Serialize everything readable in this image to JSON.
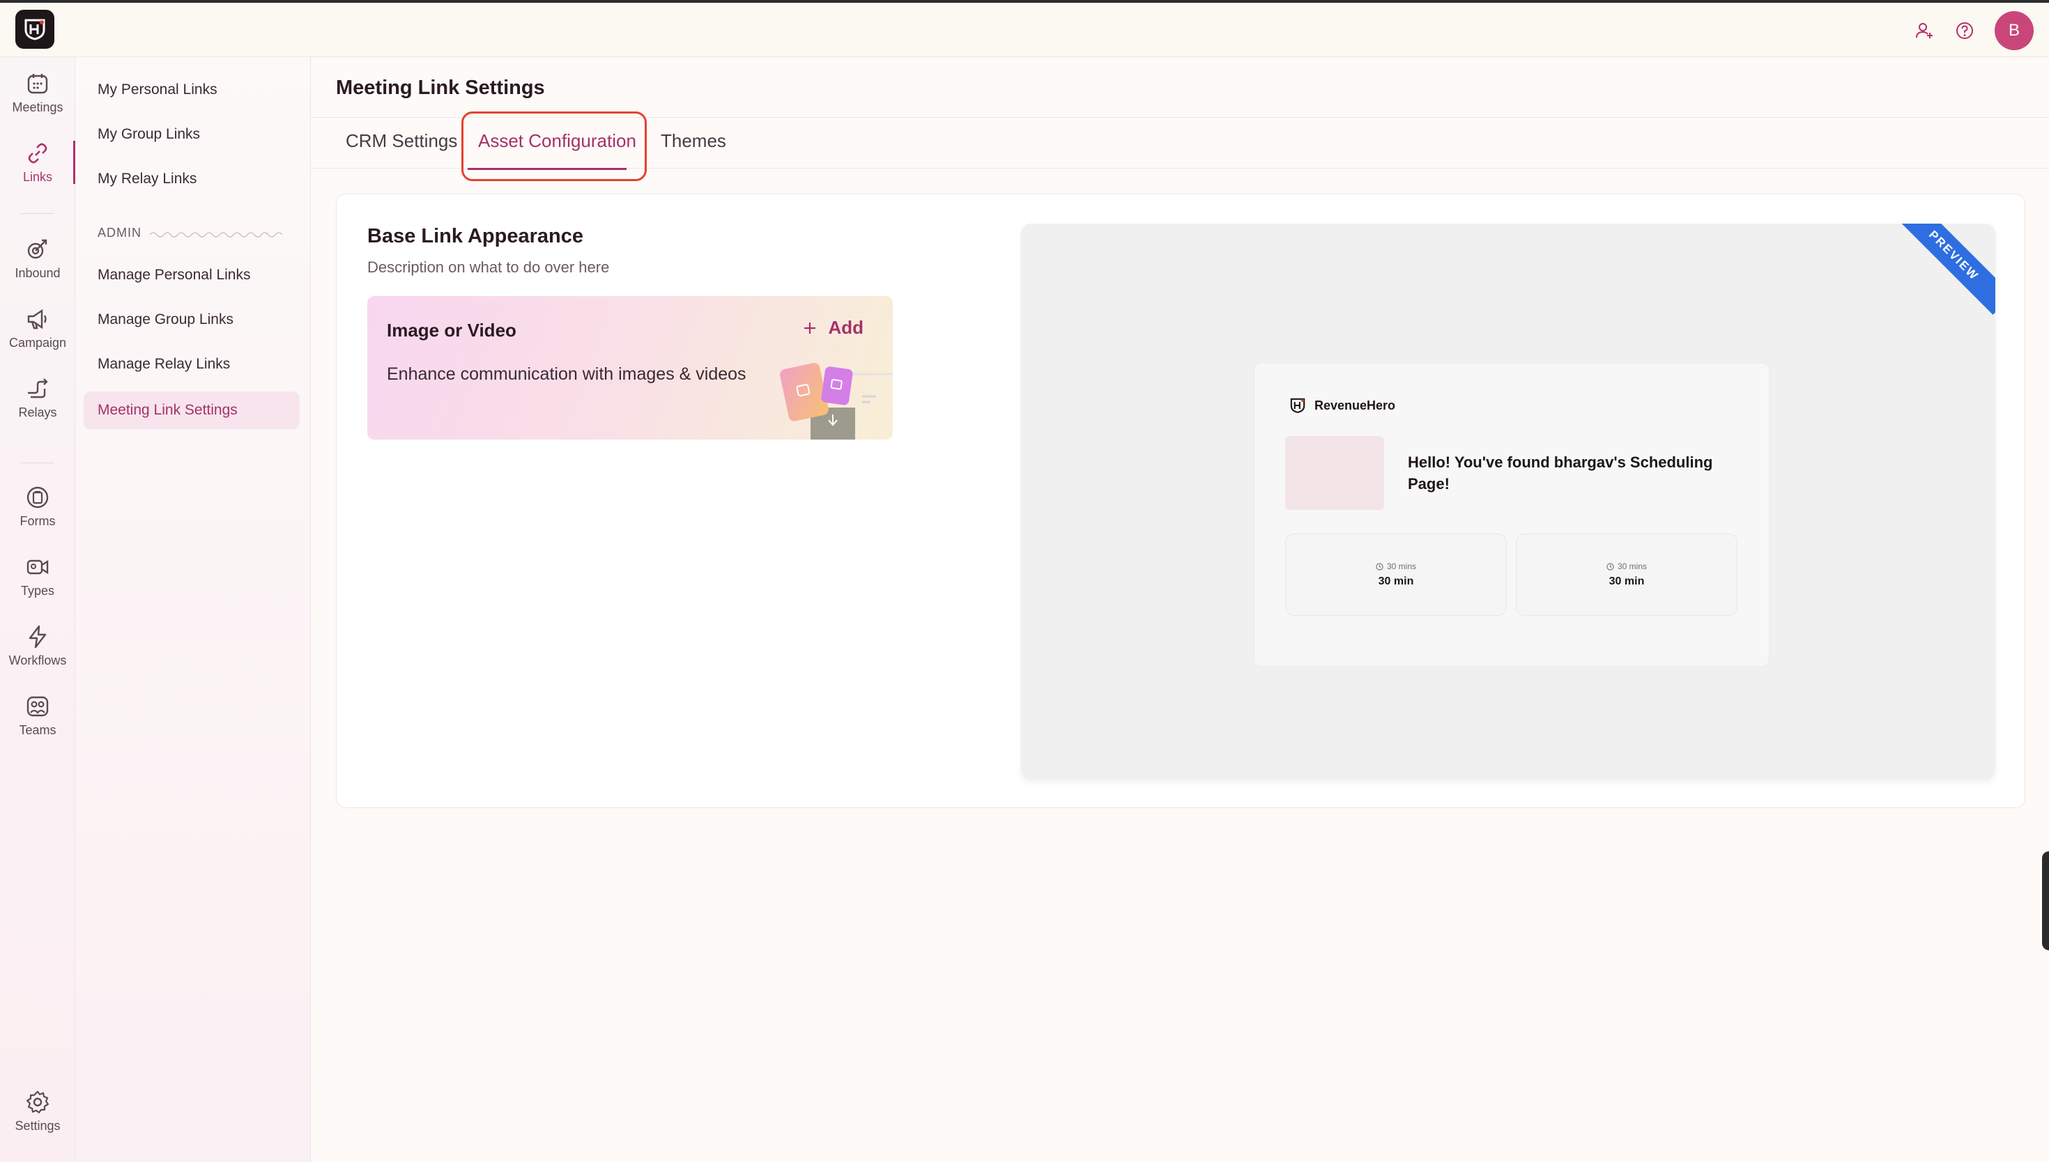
{
  "topbar": {
    "avatar_initial": "B",
    "icons": [
      "add-user-icon",
      "help-icon"
    ]
  },
  "rail": {
    "items": [
      {
        "label": "Meetings",
        "icon": "calendar-icon"
      },
      {
        "label": "Links",
        "icon": "link-icon",
        "active": true
      },
      {
        "label": "Inbound",
        "icon": "inbound-icon"
      },
      {
        "label": "Campaign",
        "icon": "megaphone-icon"
      },
      {
        "label": "Relays",
        "icon": "relay-icon"
      },
      {
        "label": "Forms",
        "icon": "forms-icon"
      },
      {
        "label": "Types",
        "icon": "video-icon"
      },
      {
        "label": "Workflows",
        "icon": "lightning-icon"
      },
      {
        "label": "Teams",
        "icon": "teams-icon"
      },
      {
        "label": "Settings",
        "icon": "gear-icon"
      }
    ]
  },
  "subnav": {
    "items": [
      "My Personal Links",
      "My Group Links",
      "My Relay Links"
    ],
    "admin_label": "ADMIN",
    "admin_items": [
      "Manage Personal Links",
      "Manage Group Links",
      "Manage Relay Links",
      "Meeting Link Settings"
    ]
  },
  "main": {
    "title": "Meeting Link Settings",
    "tabs": [
      "CRM Settings",
      "Asset Configuration",
      "Themes"
    ],
    "active_tab": "Asset Configuration",
    "section": {
      "title": "Base Link Appearance",
      "description": "Description on what to do over here",
      "asset": {
        "title": "Image or Video",
        "description": "Enhance communication with images & videos",
        "add_label": "Add"
      }
    },
    "preview": {
      "ribbon": "PREVIEW",
      "brand": "RevenueHero",
      "heading": "Hello! You've found bhargav's Scheduling Page!",
      "cards": [
        {
          "meta": "30 mins",
          "title": "30 min"
        },
        {
          "meta": "30 mins",
          "title": "30 min"
        }
      ]
    }
  },
  "colors": {
    "accent": "#a5316a",
    "avatar": "#c9467a",
    "highlight": "#e2432f",
    "ribbon": "#2f6ee0"
  }
}
